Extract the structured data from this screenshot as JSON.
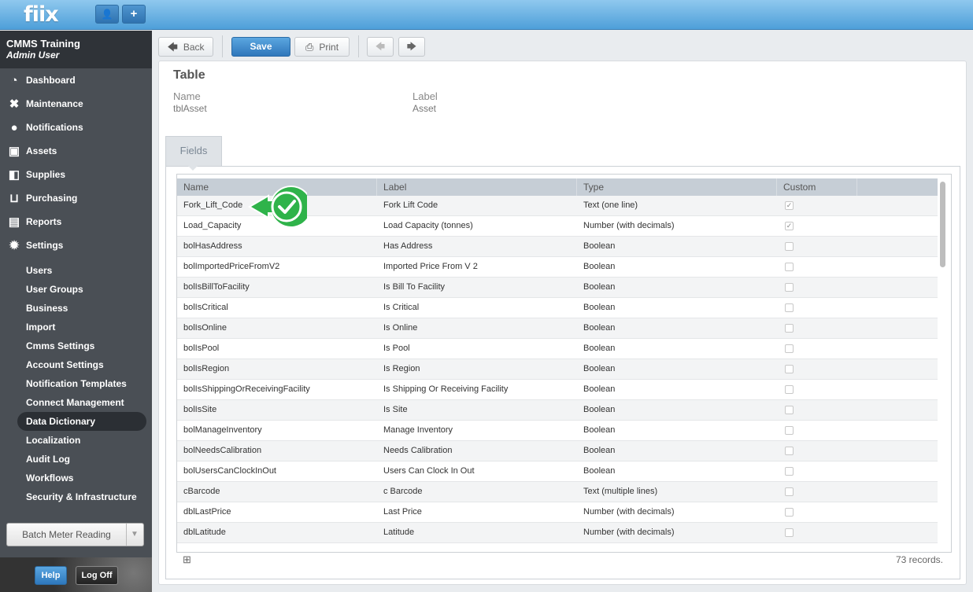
{
  "app": {
    "logo": "fiix"
  },
  "topbar": {
    "user_icon": "user-icon",
    "add_icon": "plus-icon",
    "user_glyph": "👤",
    "add_glyph": "+"
  },
  "sidebar": {
    "org_name": "CMMS Training",
    "user_name": "Admin User",
    "main_items": [
      {
        "label": "Dashboard",
        "icon": "dashboard-icon",
        "glyph": "◔"
      },
      {
        "label": "Maintenance",
        "icon": "wrench-icon",
        "glyph": "✖"
      },
      {
        "label": "Notifications",
        "icon": "chat-bubble-icon",
        "glyph": "●"
      },
      {
        "label": "Assets",
        "icon": "boxes-icon",
        "glyph": "▣"
      },
      {
        "label": "Supplies",
        "icon": "truck-icon",
        "glyph": "◧"
      },
      {
        "label": "Purchasing",
        "icon": "cart-icon",
        "glyph": "⊔"
      },
      {
        "label": "Reports",
        "icon": "chart-icon",
        "glyph": "▤"
      },
      {
        "label": "Settings",
        "icon": "gear-icon",
        "glyph": "✹"
      }
    ],
    "sub_items": [
      "Users",
      "User Groups",
      "Business",
      "Import",
      "Cmms Settings",
      "Account Settings",
      "Notification Templates",
      "Connect Management",
      "Data Dictionary",
      "Localization",
      "Audit Log",
      "Workflows",
      "Security & Infrastructure"
    ],
    "active_sub": "Data Dictionary",
    "batch_label": "Batch Meter Reading",
    "batch_caret": "▼",
    "help_label": "Help",
    "logoff_label": "Log Off"
  },
  "toolbar": {
    "back_label": "Back",
    "save_label": "Save",
    "print_label": "Print",
    "back_glyph": "🡄",
    "print_glyph": "⎙",
    "prev_glyph": "🡄",
    "next_glyph": "🡆"
  },
  "table_info": {
    "heading": "Table",
    "name_label": "Name",
    "name_value": "tblAsset",
    "label_label": "Label",
    "label_value": "Asset"
  },
  "tabs": {
    "fields_label": "Fields"
  },
  "grid": {
    "columns": [
      "Name",
      "Label",
      "Type",
      "Custom"
    ],
    "rows": [
      {
        "name": "Fork_Lift_Code",
        "label": "Fork Lift Code",
        "type": "Text (one line)",
        "custom": true
      },
      {
        "name": "Load_Capacity",
        "label": "Load Capacity (tonnes)",
        "type": "Number (with decimals)",
        "custom": true
      },
      {
        "name": "bolHasAddress",
        "label": "Has Address",
        "type": "Boolean",
        "custom": false
      },
      {
        "name": "bolImportedPriceFromV2",
        "label": "Imported Price From V 2",
        "type": "Boolean",
        "custom": false
      },
      {
        "name": "bolIsBillToFacility",
        "label": "Is Bill To Facility",
        "type": "Boolean",
        "custom": false
      },
      {
        "name": "bolIsCritical",
        "label": "Is Critical",
        "type": "Boolean",
        "custom": false
      },
      {
        "name": "bolIsOnline",
        "label": "Is Online",
        "type": "Boolean",
        "custom": false
      },
      {
        "name": "bolIsPool",
        "label": "Is Pool",
        "type": "Boolean",
        "custom": false
      },
      {
        "name": "bolIsRegion",
        "label": "Is Region",
        "type": "Boolean",
        "custom": false
      },
      {
        "name": "bolIsShippingOrReceivingFacility",
        "label": "Is Shipping Or Receiving Facility",
        "type": "Boolean",
        "custom": false
      },
      {
        "name": "bolIsSite",
        "label": "Is Site",
        "type": "Boolean",
        "custom": false
      },
      {
        "name": "bolManageInventory",
        "label": "Manage Inventory",
        "type": "Boolean",
        "custom": false
      },
      {
        "name": "bolNeedsCalibration",
        "label": "Needs Calibration",
        "type": "Boolean",
        "custom": false
      },
      {
        "name": "bolUsersCanClockInOut",
        "label": "Users Can Clock In Out",
        "type": "Boolean",
        "custom": false
      },
      {
        "name": "cBarcode",
        "label": "c Barcode",
        "type": "Text (multiple lines)",
        "custom": false
      },
      {
        "name": "dblLastPrice",
        "label": "Last Price",
        "type": "Number (with decimals)",
        "custom": false
      },
      {
        "name": "dblLatitude",
        "label": "Latitude",
        "type": "Number (with decimals)",
        "custom": false
      }
    ],
    "records_text": "73 records.",
    "scroll_fraction": 0.23,
    "check_glyph": "✓",
    "add_glyph": "⊞"
  },
  "callout": {
    "icon": "green-checkmark-callout-icon",
    "color": "#2fb34a"
  }
}
